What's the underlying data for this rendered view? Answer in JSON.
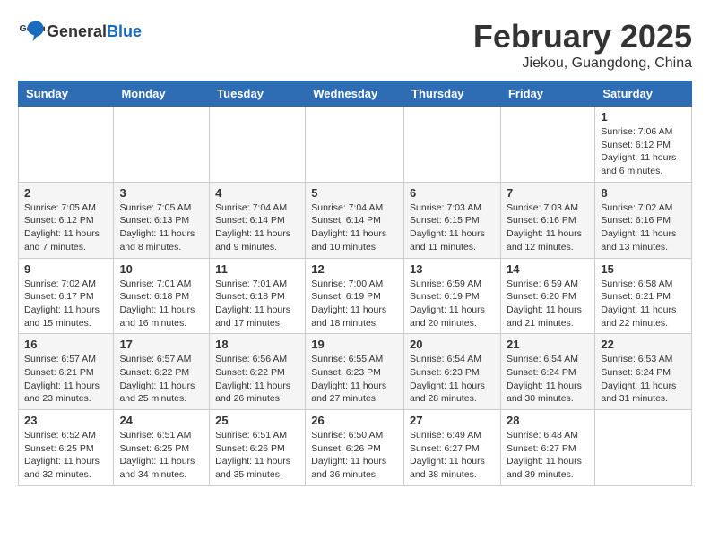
{
  "header": {
    "logo_general": "General",
    "logo_blue": "Blue",
    "month_title": "February 2025",
    "location": "Jiekou, Guangdong, China"
  },
  "calendar": {
    "days_of_week": [
      "Sunday",
      "Monday",
      "Tuesday",
      "Wednesday",
      "Thursday",
      "Friday",
      "Saturday"
    ],
    "weeks": [
      [
        {
          "day": "",
          "info": ""
        },
        {
          "day": "",
          "info": ""
        },
        {
          "day": "",
          "info": ""
        },
        {
          "day": "",
          "info": ""
        },
        {
          "day": "",
          "info": ""
        },
        {
          "day": "",
          "info": ""
        },
        {
          "day": "1",
          "info": "Sunrise: 7:06 AM\nSunset: 6:12 PM\nDaylight: 11 hours and 6 minutes."
        }
      ],
      [
        {
          "day": "2",
          "info": "Sunrise: 7:05 AM\nSunset: 6:12 PM\nDaylight: 11 hours and 7 minutes."
        },
        {
          "day": "3",
          "info": "Sunrise: 7:05 AM\nSunset: 6:13 PM\nDaylight: 11 hours and 8 minutes."
        },
        {
          "day": "4",
          "info": "Sunrise: 7:04 AM\nSunset: 6:14 PM\nDaylight: 11 hours and 9 minutes."
        },
        {
          "day": "5",
          "info": "Sunrise: 7:04 AM\nSunset: 6:14 PM\nDaylight: 11 hours and 10 minutes."
        },
        {
          "day": "6",
          "info": "Sunrise: 7:03 AM\nSunset: 6:15 PM\nDaylight: 11 hours and 11 minutes."
        },
        {
          "day": "7",
          "info": "Sunrise: 7:03 AM\nSunset: 6:16 PM\nDaylight: 11 hours and 12 minutes."
        },
        {
          "day": "8",
          "info": "Sunrise: 7:02 AM\nSunset: 6:16 PM\nDaylight: 11 hours and 13 minutes."
        }
      ],
      [
        {
          "day": "9",
          "info": "Sunrise: 7:02 AM\nSunset: 6:17 PM\nDaylight: 11 hours and 15 minutes."
        },
        {
          "day": "10",
          "info": "Sunrise: 7:01 AM\nSunset: 6:18 PM\nDaylight: 11 hours and 16 minutes."
        },
        {
          "day": "11",
          "info": "Sunrise: 7:01 AM\nSunset: 6:18 PM\nDaylight: 11 hours and 17 minutes."
        },
        {
          "day": "12",
          "info": "Sunrise: 7:00 AM\nSunset: 6:19 PM\nDaylight: 11 hours and 18 minutes."
        },
        {
          "day": "13",
          "info": "Sunrise: 6:59 AM\nSunset: 6:19 PM\nDaylight: 11 hours and 20 minutes."
        },
        {
          "day": "14",
          "info": "Sunrise: 6:59 AM\nSunset: 6:20 PM\nDaylight: 11 hours and 21 minutes."
        },
        {
          "day": "15",
          "info": "Sunrise: 6:58 AM\nSunset: 6:21 PM\nDaylight: 11 hours and 22 minutes."
        }
      ],
      [
        {
          "day": "16",
          "info": "Sunrise: 6:57 AM\nSunset: 6:21 PM\nDaylight: 11 hours and 23 minutes."
        },
        {
          "day": "17",
          "info": "Sunrise: 6:57 AM\nSunset: 6:22 PM\nDaylight: 11 hours and 25 minutes."
        },
        {
          "day": "18",
          "info": "Sunrise: 6:56 AM\nSunset: 6:22 PM\nDaylight: 11 hours and 26 minutes."
        },
        {
          "day": "19",
          "info": "Sunrise: 6:55 AM\nSunset: 6:23 PM\nDaylight: 11 hours and 27 minutes."
        },
        {
          "day": "20",
          "info": "Sunrise: 6:54 AM\nSunset: 6:23 PM\nDaylight: 11 hours and 28 minutes."
        },
        {
          "day": "21",
          "info": "Sunrise: 6:54 AM\nSunset: 6:24 PM\nDaylight: 11 hours and 30 minutes."
        },
        {
          "day": "22",
          "info": "Sunrise: 6:53 AM\nSunset: 6:24 PM\nDaylight: 11 hours and 31 minutes."
        }
      ],
      [
        {
          "day": "23",
          "info": "Sunrise: 6:52 AM\nSunset: 6:25 PM\nDaylight: 11 hours and 32 minutes."
        },
        {
          "day": "24",
          "info": "Sunrise: 6:51 AM\nSunset: 6:25 PM\nDaylight: 11 hours and 34 minutes."
        },
        {
          "day": "25",
          "info": "Sunrise: 6:51 AM\nSunset: 6:26 PM\nDaylight: 11 hours and 35 minutes."
        },
        {
          "day": "26",
          "info": "Sunrise: 6:50 AM\nSunset: 6:26 PM\nDaylight: 11 hours and 36 minutes."
        },
        {
          "day": "27",
          "info": "Sunrise: 6:49 AM\nSunset: 6:27 PM\nDaylight: 11 hours and 38 minutes."
        },
        {
          "day": "28",
          "info": "Sunrise: 6:48 AM\nSunset: 6:27 PM\nDaylight: 11 hours and 39 minutes."
        },
        {
          "day": "",
          "info": ""
        }
      ]
    ]
  }
}
